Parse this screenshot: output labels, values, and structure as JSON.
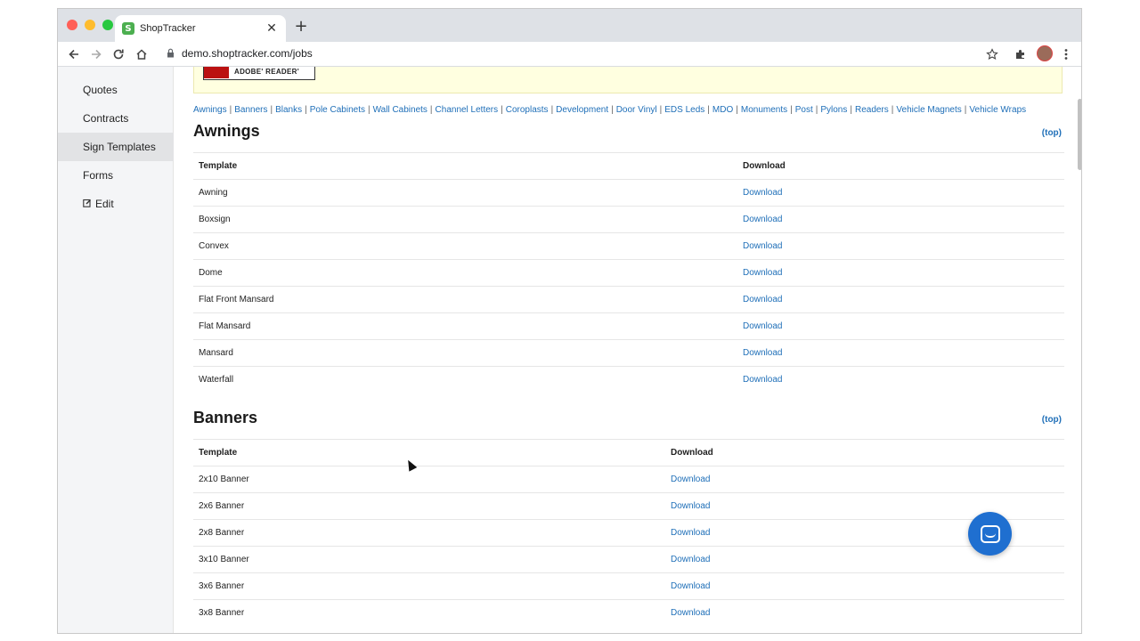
{
  "browser": {
    "tab_title": "ShopTracker",
    "favicon_text": "S",
    "close_glyph": "✕",
    "new_tab_glyph": "+",
    "url": "demo.shoptracker.com/jobs",
    "light_colors": [
      "#ff5f57",
      "#febc2e",
      "#28c840"
    ]
  },
  "sidebar": {
    "items": [
      {
        "label": "Quotes",
        "active": false
      },
      {
        "label": "Contracts",
        "active": false
      },
      {
        "label": "Sign Templates",
        "active": true
      },
      {
        "label": "Forms",
        "active": false
      },
      {
        "label": "Edit",
        "active": false
      }
    ]
  },
  "banner": {
    "adobe_text": "ADOBE' READER'"
  },
  "nav_links": [
    "Awnings",
    "Banners",
    "Blanks",
    "Pole Cabinets",
    "Wall Cabinets",
    "Channel Letters",
    "Coroplasts",
    "Development",
    "Door Vinyl",
    "EDS Leds",
    "MDO",
    "Monuments",
    "Post",
    "Pylons",
    "Readers",
    "Vehicle Magnets",
    "Vehicle Wraps"
  ],
  "sections": [
    {
      "title": "Awnings",
      "top_label": "(top)",
      "header": {
        "template": "Template",
        "download": "Download"
      },
      "rows": [
        {
          "name": "Awning",
          "link": "Download"
        },
        {
          "name": "Boxsign",
          "link": "Download"
        },
        {
          "name": "Convex",
          "link": "Download"
        },
        {
          "name": "Dome",
          "link": "Download"
        },
        {
          "name": "Flat Front Mansard",
          "link": "Download"
        },
        {
          "name": "Flat Mansard",
          "link": "Download"
        },
        {
          "name": "Mansard",
          "link": "Download"
        },
        {
          "name": "Waterfall",
          "link": "Download"
        }
      ]
    },
    {
      "title": "Banners",
      "top_label": "(top)",
      "header": {
        "template": "Template",
        "download": "Download"
      },
      "rows": [
        {
          "name": "2x10 Banner",
          "link": "Download"
        },
        {
          "name": "2x6 Banner",
          "link": "Download"
        },
        {
          "name": "2x8 Banner",
          "link": "Download"
        },
        {
          "name": "3x10 Banner",
          "link": "Download"
        },
        {
          "name": "3x6 Banner",
          "link": "Download"
        },
        {
          "name": "3x8 Banner",
          "link": "Download"
        }
      ]
    }
  ],
  "colors": {
    "link": "#1f6fb8",
    "chat": "#1f6fd0",
    "banner_bg": "#ffffe0"
  }
}
